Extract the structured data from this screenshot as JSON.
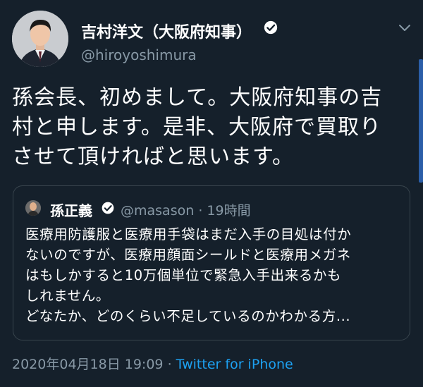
{
  "tweet": {
    "author": {
      "display_name": "吉村洋文（大阪府知事）",
      "handle": "@hiroyoshimura",
      "verified": true
    },
    "text": "孫会長、初めまして。大阪府知事の吉\n村と申します。是非、大阪府で買取り\nさせて頂ければと思います。",
    "timestamp": "2020年04月18日 19:09",
    "separator": "·",
    "source": "Twitter for iPhone"
  },
  "quoted_tweet": {
    "display_name": "孫正義",
    "handle": "@masason",
    "time": "19時間",
    "separator": "·",
    "verified": true,
    "text": "医療用防護服と医療用手袋はまだ入手の目処は付か\nないのですが、医療用顔面シールドと医療用メガネ\nはもしかすると10万個単位で緊急入手出来るかも\nしれません。\nどなたか、どのくらい不足しているのかわかる方..."
  },
  "colors": {
    "background": "#15202b",
    "text": "#ffffff",
    "muted": "#8899a6",
    "accent": "#1da1f2",
    "border": "#38444d"
  },
  "icons": {
    "verified": "verified-badge-icon",
    "menu": "chevron-down-icon"
  }
}
